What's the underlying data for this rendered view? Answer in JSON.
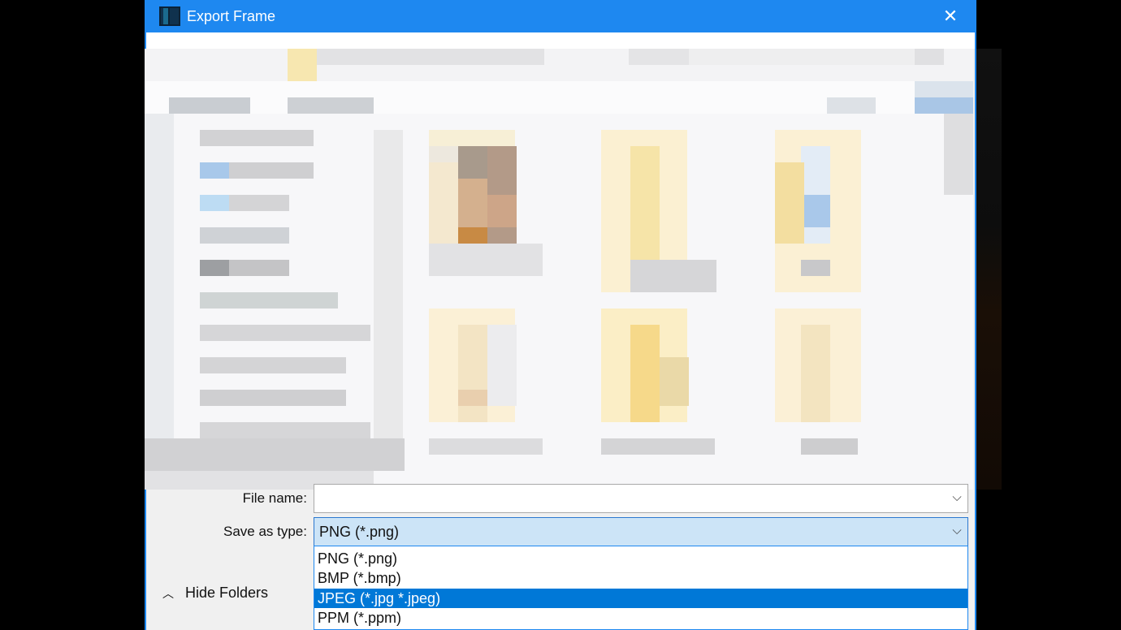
{
  "window": {
    "title": "Export Frame",
    "close_glyph": "✕",
    "accent": "#1e88f0"
  },
  "form": {
    "file_name_label": "File name:",
    "file_name_value": "",
    "save_type_label": "Save as type:",
    "save_type_value": "PNG (*.png)"
  },
  "dropdown": {
    "options": [
      {
        "label": "PNG (*.png)",
        "highlighted": false
      },
      {
        "label": "BMP (*.bmp)",
        "highlighted": false
      },
      {
        "label": "JPEG (*.jpg *.jpeg)",
        "highlighted": true
      },
      {
        "label": "PPM (*.ppm)",
        "highlighted": false
      }
    ]
  },
  "footer": {
    "hide_folders_label": "Hide Folders"
  },
  "icons": {
    "app": "film-frame-icon",
    "close": "close-icon",
    "chevron": "chevron-down-icon",
    "caret": "chevron-up-icon"
  }
}
